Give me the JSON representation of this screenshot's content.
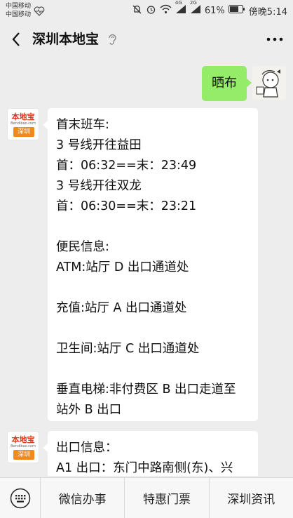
{
  "status_bar": {
    "carrier_1": "中国移动",
    "carrier_2": "中国移动",
    "network_1": "4G",
    "network_2": "2G",
    "battery": "61%",
    "time": "傍晚5:14"
  },
  "nav": {
    "title": "深圳本地宝"
  },
  "chat": {
    "user_message": "晒布",
    "bot_avatar": {
      "brand": "本地宝",
      "url": "Bendibao.com",
      "city": "深圳"
    },
    "message_1": [
      "首末班车:",
      "3 号线开往益田",
      "首：06:32==末：23:49",
      "3 号线开往双龙",
      "首：06:30==末：23:21",
      "",
      "便民信息:",
      "ATM:站厅 D 出口通道处",
      "",
      "充值:站厅 A 出口通道处",
      "",
      "卫生间:站厅 C 出口通道处",
      "",
      "垂直电梯:非付费区 B 出口走道至",
      "站外 B 出口"
    ],
    "message_2": [
      "出口信息：",
      "A1 出口：东门中路南侧(东)、兴"
    ]
  },
  "bottom_menu": {
    "items": [
      "微信办事",
      "特惠门票",
      "深圳资讯"
    ]
  },
  "colors": {
    "background": "#ededed",
    "user_bubble": "#95ec69",
    "bot_bubble": "#ffffff"
  }
}
